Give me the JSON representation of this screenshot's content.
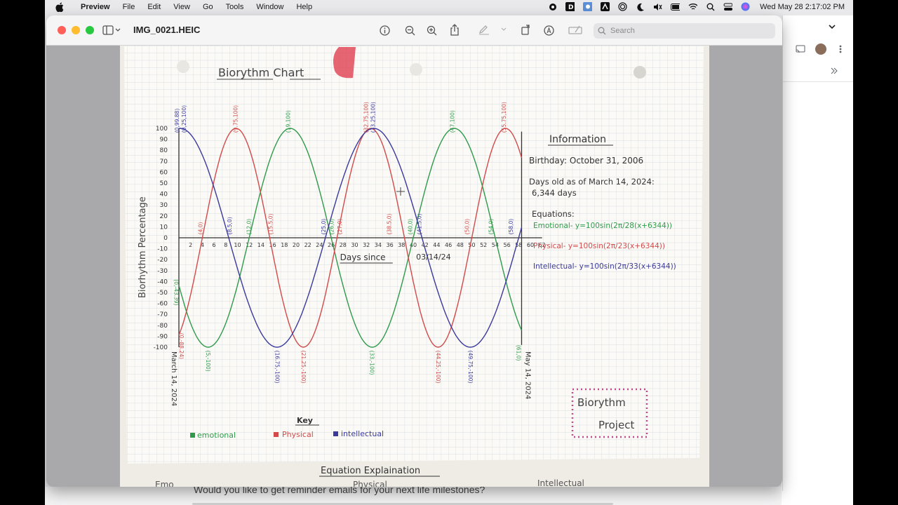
{
  "menubar": {
    "app": "Preview",
    "items": [
      "File",
      "Edit",
      "View",
      "Go",
      "Tools",
      "Window",
      "Help"
    ],
    "clock": "Wed May 28  2:17:02 PM"
  },
  "window": {
    "doc_title": "IMG_0021.HEIC",
    "search_placeholder": "Search"
  },
  "background": {
    "bottom_text": "Would you like to get reminder emails for your next life milestones?"
  },
  "photo": {
    "title": "Biorythm Chart",
    "y_label": "Biorhythm Percentage",
    "x_label_1": "Days since",
    "x_label_2": "03/14/24",
    "start_label": "March 14, 2024",
    "end_label": "May 14, 2024",
    "info": {
      "heading": "Information",
      "birthday": "Birthday: October 31, 2006",
      "days_old_1": "Days old as of March 14, 2024:",
      "days_old_2": "6,344 days",
      "equations_heading": "Equations:",
      "eq_emotional": "Emotional- y=100sin(2π/28(x+6344))",
      "eq_physical": "Physical- y=100sin(2π/23(x+6344))",
      "eq_intellectual": "Intellectual- y=100sin(2π/33(x+6344))"
    },
    "key": {
      "heading": "Key",
      "emotional": "emotional",
      "physical": "Physical",
      "intellectual": "intellectual"
    },
    "stamp_1": "Biorythm",
    "stamp_2": "Project",
    "bottom_heading": "Equation Explaination",
    "bottom_left": "Emo",
    "bottom_mid": "Physical",
    "bottom_right": "Intellectual",
    "ticks_y": [
      "100",
      "90",
      "80",
      "70",
      "60",
      "50",
      "40",
      "30",
      "20",
      "10",
      "0",
      "-10",
      "-20",
      "-30",
      "-40",
      "-50",
      "-60",
      "-70",
      "-80",
      "-90",
      "-100"
    ],
    "ticks_x": [
      "2",
      "4",
      "6",
      "8",
      "10",
      "12",
      "14",
      "16",
      "18",
      "20",
      "22",
      "24",
      "26",
      "28",
      "30",
      "32",
      "34",
      "36",
      "38",
      "40",
      "42",
      "44",
      "46",
      "48",
      "50",
      "52",
      "54",
      "56",
      "58",
      "60",
      "62"
    ],
    "annotations": [
      {
        "text": "(0,99.88)",
        "color": "#3b3a9c"
      },
      {
        "text": "(0,25,100)",
        "color": "#3b3a9c"
      },
      {
        "text": "(9.75,100)",
        "color": "#d14b4b"
      },
      {
        "text": "(19,100)",
        "color": "#2f9a4a"
      },
      {
        "text": "(32.75,100)",
        "color": "#d14b4b"
      },
      {
        "text": "(33.25,100)",
        "color": "#3b3a9c"
      },
      {
        "text": "(47,100)",
        "color": "#2f9a4a"
      },
      {
        "text": "(55.75,100)",
        "color": "#d14b4b"
      },
      {
        "text": "(4,0)",
        "color": "#d14b4b"
      },
      {
        "text": "(8.5,0)",
        "color": "#3b3a9c"
      },
      {
        "text": "(12,0)",
        "color": "#2f9a4a"
      },
      {
        "text": "(15.5,0)",
        "color": "#d14b4b"
      },
      {
        "text": "(25,0)",
        "color": "#3b3a9c"
      },
      {
        "text": "(26,0)",
        "color": "#2f9a4a"
      },
      {
        "text": "(27,0)",
        "color": "#d14b4b"
      },
      {
        "text": "(38.5,0)",
        "color": "#d14b4b"
      },
      {
        "text": "(40,0)",
        "color": "#2f9a4a"
      },
      {
        "text": "(41.5,0)",
        "color": "#3b3a9c"
      },
      {
        "text": "(50,0)",
        "color": "#d14b4b"
      },
      {
        "text": "(54,0)",
        "color": "#2f9a4a"
      },
      {
        "text": "(58,0)",
        "color": "#3b3a9c"
      },
      {
        "text": "(0,-43.39)",
        "color": "#2f9a4a"
      },
      {
        "text": "(0,-88.24)",
        "color": "#d14b4b"
      },
      {
        "text": "(5,-100)",
        "color": "#2f9a4a"
      },
      {
        "text": "(16.75,-100)",
        "color": "#3b3a9c"
      },
      {
        "text": "(21.25,-100)",
        "color": "#d14b4b"
      },
      {
        "text": "(33,-100)",
        "color": "#2f9a4a"
      },
      {
        "text": "(44.25,-100)",
        "color": "#d14b4b"
      },
      {
        "text": "(49.75,-100)",
        "color": "#3b3a9c"
      },
      {
        "text": "(61,0)",
        "color": "#2f9a4a"
      }
    ]
  },
  "colors": {
    "emotional": "#2f9a4a",
    "physical": "#d14b4b",
    "intellectual": "#3b3a9c",
    "grid": "#cfd6dc"
  }
}
